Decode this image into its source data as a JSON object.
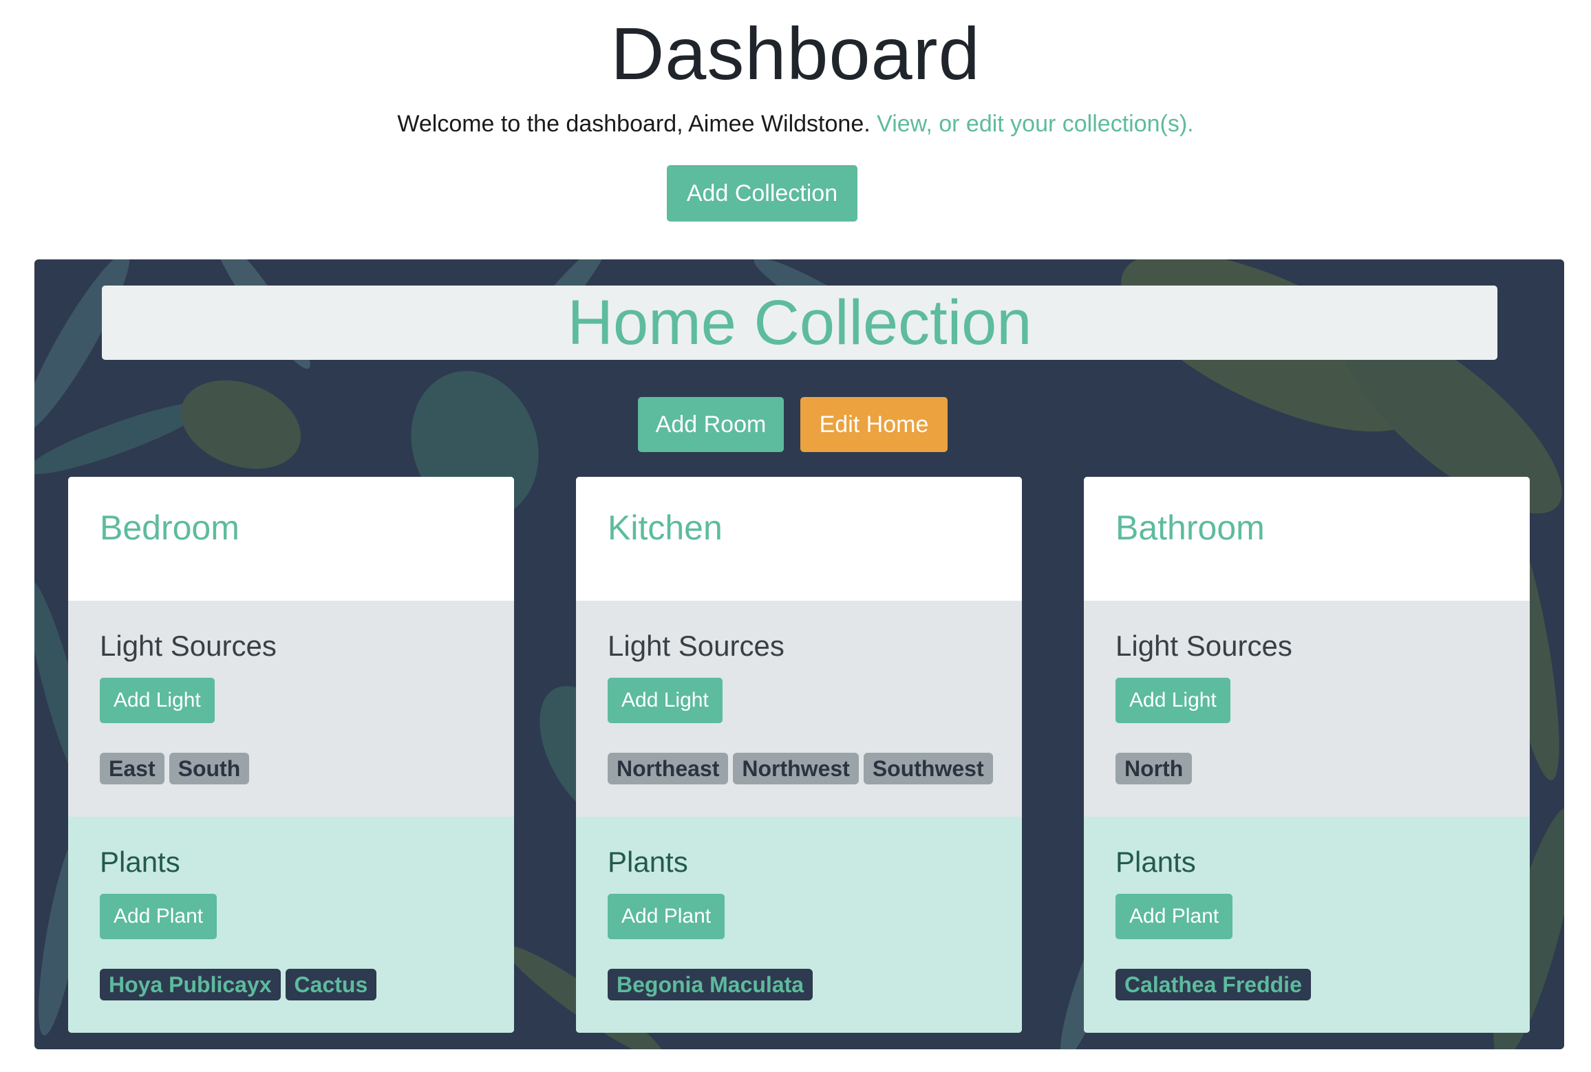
{
  "header": {
    "title": "Dashboard",
    "welcome_text": "Welcome to the dashboard, Aimee Wildstone.",
    "welcome_link": "View, or edit your collection(s).",
    "add_collection_label": "Add Collection"
  },
  "collection": {
    "title": "Home Collection",
    "add_room_label": "Add Room",
    "edit_label": "Edit Home",
    "rooms": [
      {
        "name": "Bedroom",
        "lights_title": "Light Sources",
        "add_light_label": "Add Light",
        "lights": [
          "East",
          "South"
        ],
        "plants_title": "Plants",
        "add_plant_label": "Add Plant",
        "plants": [
          "Hoya Publicayx",
          "Cactus"
        ]
      },
      {
        "name": "Kitchen",
        "lights_title": "Light Sources",
        "add_light_label": "Add Light",
        "lights": [
          "Northeast",
          "Northwest",
          "Southwest"
        ],
        "plants_title": "Plants",
        "add_plant_label": "Add Plant",
        "plants": [
          "Begonia Maculata"
        ]
      },
      {
        "name": "Bathroom",
        "lights_title": "Light Sources",
        "add_light_label": "Add Light",
        "lights": [
          "North"
        ],
        "plants_title": "Plants",
        "add_plant_label": "Add Plant",
        "plants": [
          "Calathea Freddie"
        ]
      }
    ]
  },
  "colors": {
    "accent": "#5dbb9e",
    "edit": "#eba23f",
    "panel_bg": "#2e3a4f",
    "light_tag": "#9aa4a8",
    "plants_bg": "#c9eae2"
  }
}
